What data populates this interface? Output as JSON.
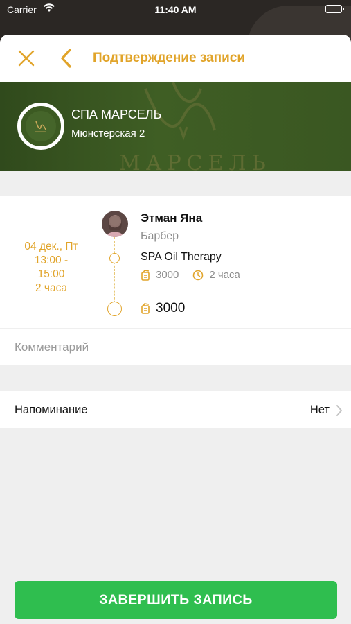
{
  "status_bar": {
    "carrier": "Carrier",
    "time": "11:40 AM"
  },
  "nav": {
    "title": "Подтверждение записи"
  },
  "salon": {
    "name": "СПА МАРСЕЛЬ",
    "address": "Мюнстерская 2",
    "watermark": "МАРСЕЛЬ"
  },
  "appointment": {
    "date": "04 дек., Пт",
    "time_range": "13:00 -",
    "time_end": "15:00",
    "duration": "2 часа",
    "master_name": "Этман Яна",
    "master_role": "Барбер",
    "service_name": "SPA Oil Therapy",
    "service_price": "3000",
    "service_duration": "2 часа",
    "total": "3000"
  },
  "comment": {
    "placeholder": "Комментарий"
  },
  "reminder": {
    "label": "Напоминание",
    "value": "Нет"
  },
  "footer": {
    "finish_label": "ЗАВЕРШИТЬ ЗАПИСЬ"
  },
  "colors": {
    "accent": "#e1a42a",
    "banner": "#3f5e24",
    "button": "#2fbe4f"
  }
}
